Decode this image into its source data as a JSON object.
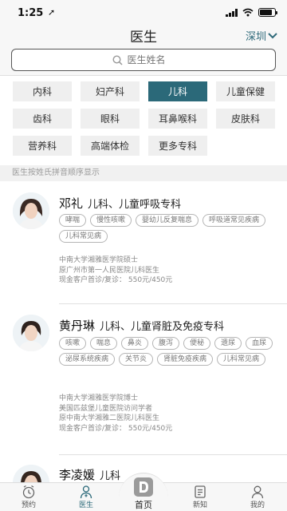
{
  "status": {
    "time": "1:25",
    "location_glyph": "➚"
  },
  "nav": {
    "title": "医生",
    "city": "深圳"
  },
  "search": {
    "placeholder": "医生姓名"
  },
  "departments": [
    {
      "label": "内科",
      "active": false
    },
    {
      "label": "妇产科",
      "active": false
    },
    {
      "label": "儿科",
      "active": true
    },
    {
      "label": "儿童保健",
      "active": false
    },
    {
      "label": "齿科",
      "active": false
    },
    {
      "label": "眼科",
      "active": false
    },
    {
      "label": "耳鼻喉科",
      "active": false
    },
    {
      "label": "皮肤科",
      "active": false
    },
    {
      "label": "营养科",
      "active": false
    },
    {
      "label": "高端体检",
      "active": false
    },
    {
      "label": "更多专科",
      "active": false
    }
  ],
  "hint": "医生按姓氏拼音顺序显示",
  "doctors": [
    {
      "name": "邓礼",
      "specialty": "儿科、儿童呼吸专科",
      "tags": [
        "哮喘",
        "慢性咳嗽",
        "婴幼儿反复喘息",
        "呼吸道常见疾病",
        "儿科常见病"
      ],
      "info": [
        "中南大学湘雅医学院硕士",
        "原广州市第一人民医院儿科医生",
        "现金客户首诊/复诊：  550元/450元"
      ]
    },
    {
      "name": "黄丹琳",
      "specialty": "儿科、儿童肾脏及免疫专科",
      "tags": [
        "咳嗽",
        "喘息",
        "鼻炎",
        "腹泻",
        "便秘",
        "遗尿",
        "血尿",
        "泌尿系统疾病",
        "关节炎",
        "肾脏免疫疾病",
        "儿科常见病"
      ],
      "info": [
        "中南大学湘雅医学院博士",
        "美国匹兹堡儿童医院访问学者",
        "原中南大学湘雅二医院儿科医生",
        "现金客户首诊/复诊：  550元/450元"
      ]
    },
    {
      "name": "李凌媛",
      "specialty": "儿科",
      "tags": [],
      "info": []
    }
  ],
  "tabs": {
    "appointment": "预约",
    "doctor": "医生",
    "home": "首页",
    "news": "新知",
    "mine": "我的"
  },
  "colors": {
    "accent": "#2b6979",
    "background": "#f7f7f7"
  }
}
